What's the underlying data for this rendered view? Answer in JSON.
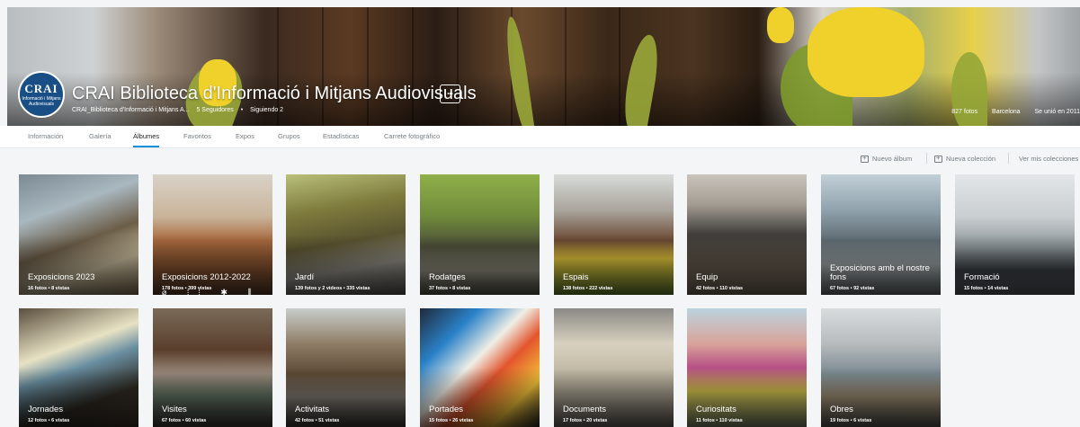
{
  "header": {
    "title": "CRAI Biblioteca d'Informació i Mitjans Audiovisuals",
    "avatar_text": "CRAI",
    "avatar_subtext": "Informació i Mitjans Audiovisuals",
    "username": "CRAI_Biblioteca d'Informació i Mitjans A...",
    "followers": "5 Seguidores",
    "dot": "•",
    "following": "Siguiendo 2",
    "photos_count": "827 fotos",
    "location": "Barcelona",
    "joined": "Se unió en 2011",
    "more_label": "•••"
  },
  "tabs": [
    {
      "label": "Información"
    },
    {
      "label": "Galería"
    },
    {
      "label": "Álbumes"
    },
    {
      "label": "Favoritos"
    },
    {
      "label": "Expos"
    },
    {
      "label": "Grupos"
    },
    {
      "label": "Estadísticas"
    },
    {
      "label": "Carrete fotográfico"
    }
  ],
  "active_tab": "Álbumes",
  "actions": {
    "new_album": "Nuevo álbum",
    "new_collection": "Nueva colección",
    "view_collections": "Ver mis colecciones"
  },
  "albums": [
    {
      "title": "Exposicions 2023",
      "stats": "16 fotos  •  8 vistas"
    },
    {
      "title": "Exposicions 2012-2022",
      "stats": "178 fotos  •  399 vistas"
    },
    {
      "title": "Jardí",
      "stats": "139 fotos y 2 videos  •  335 vistas"
    },
    {
      "title": "Rodatges",
      "stats": "37 fotos  •  8 vistas"
    },
    {
      "title": "Espais",
      "stats": "138 fotos  •  222 vistas"
    },
    {
      "title": "Equip",
      "stats": "42 fotos  •  110 vistas"
    },
    {
      "title": "Exposicions amb el nostre fons",
      "stats": "67 fotos  •  92 vistas"
    },
    {
      "title": "Formació",
      "stats": "15 fotos  •  14 vistas"
    },
    {
      "title": "Jornades",
      "stats": "12 fotos  •  6 vistas"
    },
    {
      "title": "Visites",
      "stats": "67 fotos  •  60 vistas"
    },
    {
      "title": "Activitats",
      "stats": "42 fotos  •  51 vistas"
    },
    {
      "title": "Portades",
      "stats": "15 fotos  •  26 vistas"
    },
    {
      "title": "Documents",
      "stats": "17 fotos  •  20 vistas"
    },
    {
      "title": "Curiositats",
      "stats": "11 fotos  •  110 vistas"
    },
    {
      "title": "Obres",
      "stats": "19 fotos  •  6 vistas"
    }
  ],
  "colors": {
    "accent": "#128fdc",
    "avatar_bg": "#1a4f86"
  }
}
